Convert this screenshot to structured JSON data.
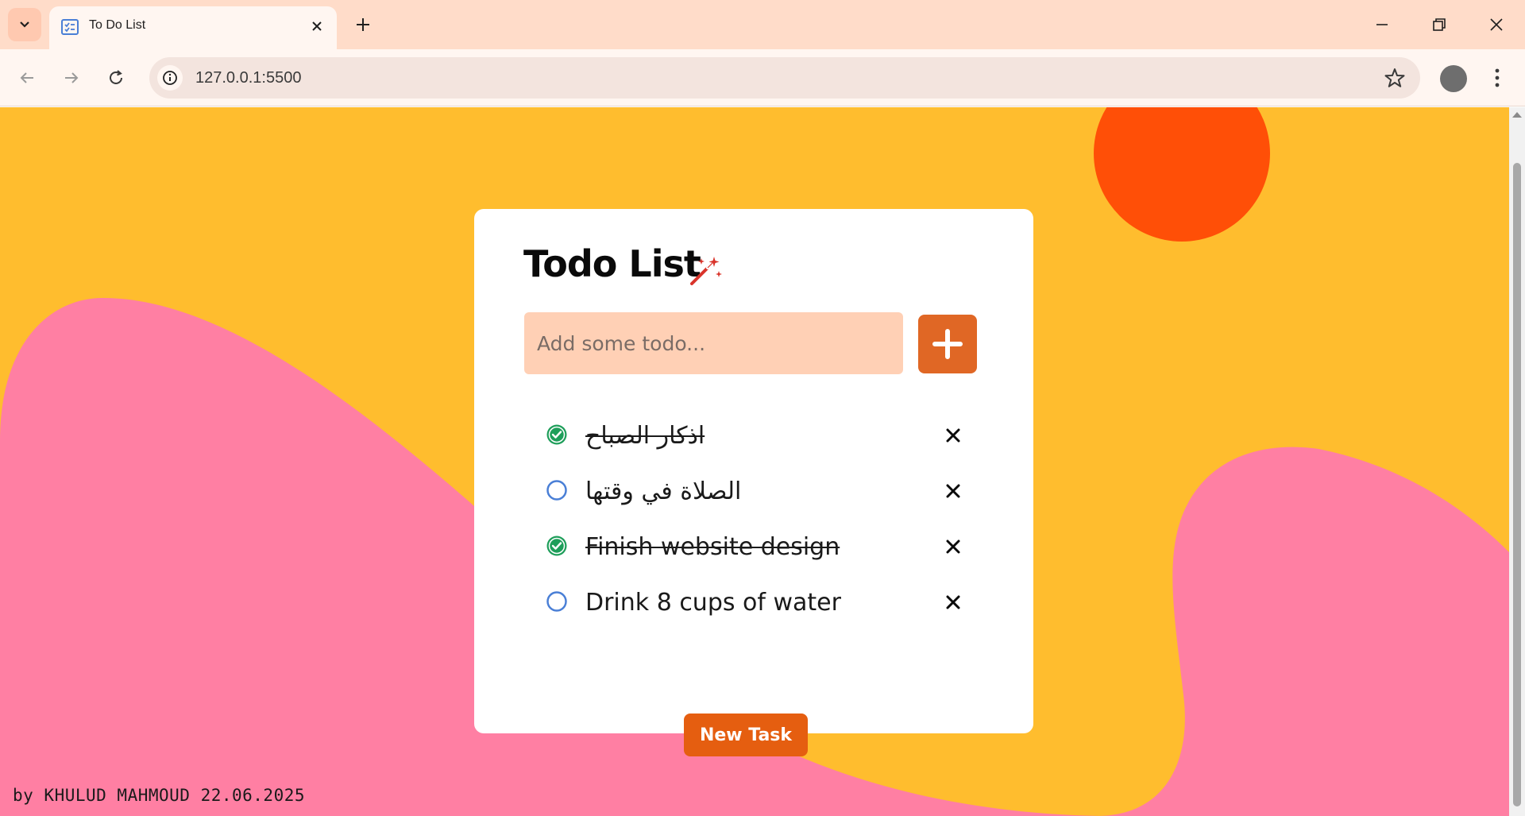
{
  "browser": {
    "tab_title": "To Do List",
    "url": "127.0.0.1:5500"
  },
  "app": {
    "title": "Todo List",
    "input_placeholder": "Add some todo...",
    "todos": [
      {
        "text": "اذكار الصباح",
        "done": true
      },
      {
        "text": "الصلاة في وقتها",
        "done": false
      },
      {
        "text": "Finish website design",
        "done": true
      },
      {
        "text": "Drink 8 cups of water",
        "done": false
      }
    ],
    "new_task_label": "New Task",
    "footer": "by KHULUD MAHMOUD 22.06.2025"
  },
  "colors": {
    "background": "#ffbd2e",
    "blob": "#ff7fa3",
    "sun": "#ff4f07",
    "accent": "#e06725",
    "input_bg": "#ffd0b5",
    "check_done": "#1e9e5a",
    "check_open": "#4a7fd6"
  },
  "icons": {
    "tab_search": "chevron-down-icon",
    "favicon": "checklist-icon",
    "title_decoration": "magic-wand-icon",
    "add": "plus-icon",
    "done": "check-circle-icon",
    "open": "circle-icon",
    "delete": "close-icon"
  }
}
